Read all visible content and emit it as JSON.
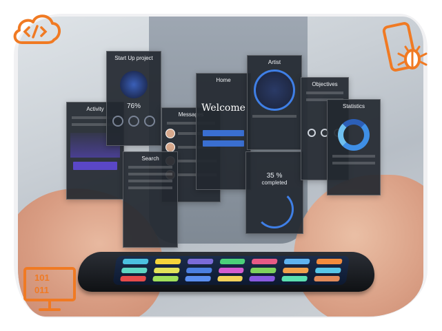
{
  "scene": {
    "cards": {
      "startup": {
        "title": "Start Up project",
        "percent": "76%"
      },
      "activity": {
        "title": "Activity",
        "button": ""
      },
      "messages": {
        "title": "Messages"
      },
      "home": {
        "title": "Home",
        "welcome": "Welcome"
      },
      "artist": {
        "title": "Artist"
      },
      "completed": {
        "percent": "35 %",
        "label": "completed"
      },
      "objectives": {
        "title": "Objectives"
      },
      "statistics": {
        "title": "Statistics"
      },
      "search": {
        "title": "Search"
      }
    }
  },
  "colors": {
    "accent": "#f07a23",
    "card_bg": "#232830",
    "blue": "#3a6fd1"
  },
  "icons": [
    "cloud-code-icon",
    "phone-bug-icon",
    "monitor-binary-icon"
  ]
}
